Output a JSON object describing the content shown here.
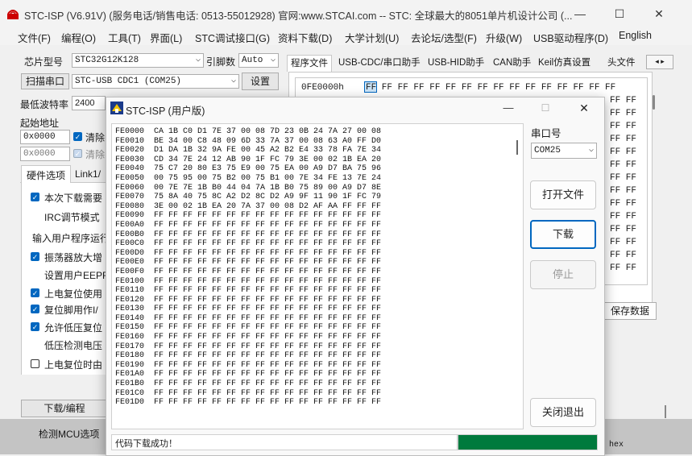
{
  "main_window": {
    "title": "STC-ISP (V6.91V) (服务电话/销售电话: 0513-55012928) 官网:www.STCAI.com  -- STC: 全球最大的8051单片机设计公司 (...",
    "minimize": "—",
    "maximize": "☐",
    "close": "✕"
  },
  "menu": [
    "文件(F)",
    "编程(O)",
    "工具(T)",
    "界面(L)",
    "STC调试接口(G)",
    "资料下载(D)",
    "大学计划(U)",
    "去论坛/选型(F)",
    "升级(W)",
    "USB驱动程序(D)",
    "English"
  ],
  "left_panel": {
    "chip_label": "芯片型号",
    "chip_value": "STC32G12K128",
    "pins_label": "引脚数",
    "pins_value": "Auto",
    "scan_button": "扫描串口",
    "port_value": "STC-USB CDC1 (COM25)",
    "settings_button": "设置",
    "min_baud_label": "最低波特率",
    "min_baud_value": "2400",
    "start_addr_label": "起始地址",
    "addr1": "0x0000",
    "clear1": "清除",
    "addr2": "0x0000",
    "clear2": "清除",
    "hw_tab": "硬件选项",
    "link_tab": "Link1/",
    "options": [
      {
        "text": "本次下载需要",
        "state": "on"
      },
      {
        "text": "IRC调节模式",
        "state": "none"
      },
      {
        "text": "输入用户程序运行",
        "state": "none"
      },
      {
        "text": "振荡器放大增",
        "state": "on"
      },
      {
        "text": "设置用户EEPRO",
        "state": "none"
      },
      {
        "text": "上电复位使用",
        "state": "on"
      },
      {
        "text": "复位脚用作I/",
        "state": "on"
      },
      {
        "text": "允许低压复位",
        "state": "on"
      },
      {
        "text": "低压检测电压",
        "state": "none"
      },
      {
        "text": "上电复位时由",
        "state": "off"
      }
    ],
    "download_button": "下载/编程",
    "detect_button": "检测MCU选项"
  },
  "right_panel": {
    "tabs": [
      "程序文件",
      "USB-CDC/串口助手",
      "USB-HID助手",
      "CAN助手",
      "Keil仿真设置",
      "头文件"
    ],
    "address": "0FE0000h",
    "hex_cells": "FF FF FF FF FF FF FF FF FF FF FF FF FF FF FF FF",
    "right_col": "FF FF",
    "save_button": "保存数据",
    "hex_label": "hex"
  },
  "dialog": {
    "title": "STC-ISP (用户版)",
    "minimize": "—",
    "maximize": "☐",
    "close": "✕",
    "port_label": "串口号",
    "port_value": "COM25",
    "open_button": "打开文件",
    "download_button": "下载",
    "stop_button": "停止",
    "exit_button": "关闭退出",
    "dump_rows": [
      "FE0000  CA 1B C0 D1 7E 37 00 08 7D 23 0B 24 7A 27 00 08",
      "FE0010  BE 34 00 C8 48 09 6D 33 7A 37 00 08 63 A0 FF D0",
      "FE0020  D1 DA 1B 32 9A FE 00 45 A2 B2 E4 33 78 FA 7E 34",
      "FE0030  CD 34 7E 24 12 AB 90 1F FC 79 3E 00 02 1B EA 20",
      "FE0040  75 C7 20 80 E3 75 E9 00 75 EA 00 A9 D7 BA 75 96",
      "FE0050  00 75 95 00 75 B2 00 75 B1 00 7E 34 FE 13 7E 24",
      "FE0060  00 7E 7E 1B B0 44 04 7A 1B B0 75 89 00 A9 D7 8E",
      "FE0070  75 8A 40 75 8C A2 D2 8C D2 A9 9F 11 90 1F FC 79",
      "FE0080  3E 00 02 1B EA 20 7A 37 00 08 D2 AF AA FF FF FF",
      "FE0090  FF FF FF FF FF FF FF FF FF FF FF FF FF FF FF FF",
      "FE00A0  FF FF FF FF FF FF FF FF FF FF FF FF FF FF FF FF",
      "FE00B0  FF FF FF FF FF FF FF FF FF FF FF FF FF FF FF FF",
      "FE00C0  FF FF FF FF FF FF FF FF FF FF FF FF FF FF FF FF",
      "FE00D0  FF FF FF FF FF FF FF FF FF FF FF FF FF FF FF FF",
      "FE00E0  FF FF FF FF FF FF FF FF FF FF FF FF FF FF FF FF",
      "FE00F0  FF FF FF FF FF FF FF FF FF FF FF FF FF FF FF FF",
      "FE0100  FF FF FF FF FF FF FF FF FF FF FF FF FF FF FF FF",
      "FE0110  FF FF FF FF FF FF FF FF FF FF FF FF FF FF FF FF",
      "FE0120  FF FF FF FF FF FF FF FF FF FF FF FF FF FF FF FF",
      "FE0130  FF FF FF FF FF FF FF FF FF FF FF FF FF FF FF FF",
      "FE0140  FF FF FF FF FF FF FF FF FF FF FF FF FF FF FF FF",
      "FE0150  FF FF FF FF FF FF FF FF FF FF FF FF FF FF FF FF",
      "FE0160  FF FF FF FF FF FF FF FF FF FF FF FF FF FF FF FF",
      "FE0170  FF FF FF FF FF FF FF FF FF FF FF FF FF FF FF FF",
      "FE0180  FF FF FF FF FF FF FF FF FF FF FF FF FF FF FF FF",
      "FE0190  FF FF FF FF FF FF FF FF FF FF FF FF FF FF FF FF",
      "FE01A0  FF FF FF FF FF FF FF FF FF FF FF FF FF FF FF FF",
      "FE01B0  FF FF FF FF FF FF FF FF FF FF FF FF FF FF FF FF",
      "FE01C0  FF FF FF FF FF FF FF FF FF FF FF FF FF FF FF FF",
      "FE01D0  FF FF FF FF FF FF FF FF FF FF FF FF FF FF FF FF"
    ],
    "status_text": "代码下载成功！"
  },
  "colors": {
    "accent": "#0067c0",
    "progress": "#007a3d",
    "selection": "#cce4f7"
  },
  "progress": 1.0
}
